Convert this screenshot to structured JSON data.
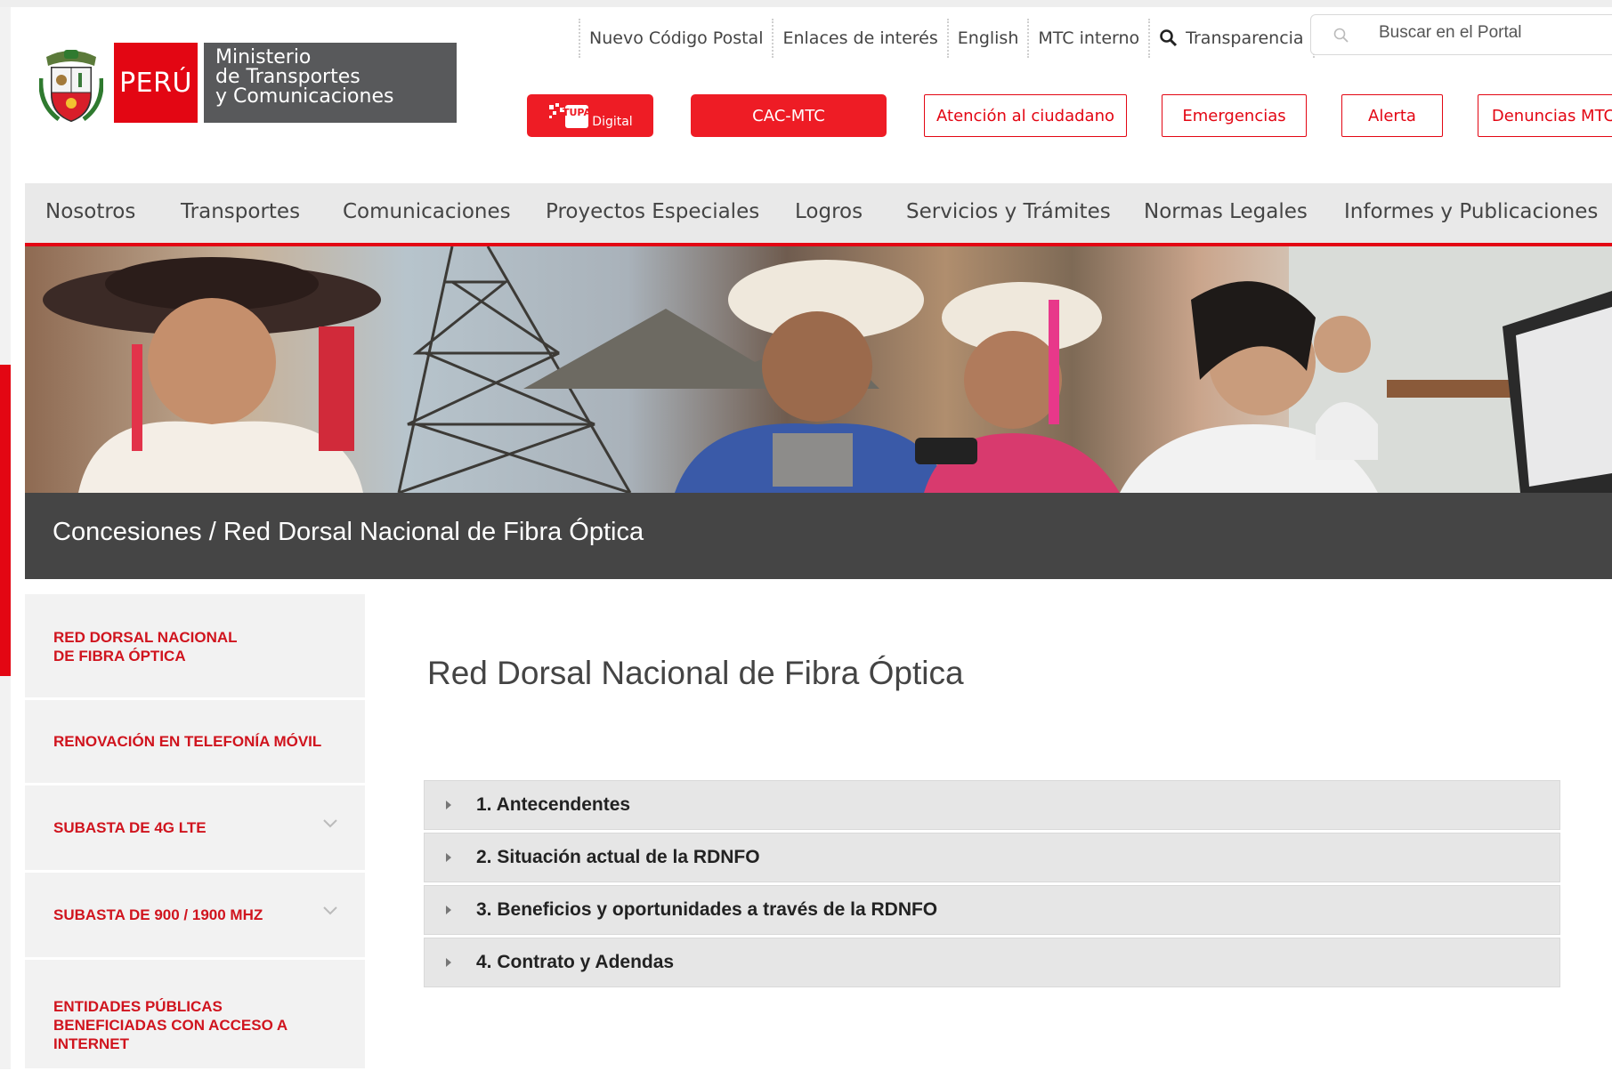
{
  "header": {
    "logo": {
      "country": "PERÚ",
      "ministry_lines": [
        "Ministerio",
        "de Transportes",
        "y Comunicaciones"
      ]
    },
    "utility_links": [
      "Nuevo Código Postal",
      "Enlaces de interés",
      "English",
      "MTC interno",
      "Transparencia"
    ],
    "search": {
      "placeholder": "Buscar en el Portal"
    },
    "buttons": {
      "tupa": {
        "mark": "TUPA",
        "suffix": "Digital"
      },
      "cac": "CAC-MTC",
      "atencion": "Atención al ciudadano",
      "emergencias": "Emergencias",
      "alerta": "Alerta",
      "denuncias": "Denuncias MTC"
    }
  },
  "nav": [
    "Nosotros",
    "Transportes",
    "Comunicaciones",
    "Proyectos Especiales",
    "Logros",
    "Servicios y Trámites",
    "Normas Legales",
    "Informes y Publicaciones"
  ],
  "page_header": {
    "breadcrumb": "Concesiones / Red Dorsal Nacional de Fibra Óptica"
  },
  "sidebar": {
    "items": [
      {
        "label": "RED DORSAL NACIONAL DE FIBRA ÓPTICA"
      },
      {
        "label": "RENOVACIÓN EN TELEFONÍA MÓVIL"
      },
      {
        "label": "SUBASTA DE 4G LTE"
      },
      {
        "label": "SUBASTA DE 900 / 1900 MHZ"
      },
      {
        "label": "ENTIDADES PÚBLICAS BENEFICIADAS CON ACCESO A INTERNET"
      }
    ]
  },
  "main": {
    "title": "Red Dorsal Nacional de Fibra Óptica",
    "accordion": [
      "1. Antecendentes",
      "2. Situación actual de la RDNFO",
      "3. Beneficios y oportunidades a través de la RDNFO",
      "4. Contrato y Adendas"
    ]
  },
  "colors": {
    "brand_red": "#e30613",
    "button_red": "#ee1c25",
    "ministry_gray": "#58595b",
    "title_bar": "#454545",
    "nav_bg": "#e9e9e9"
  }
}
